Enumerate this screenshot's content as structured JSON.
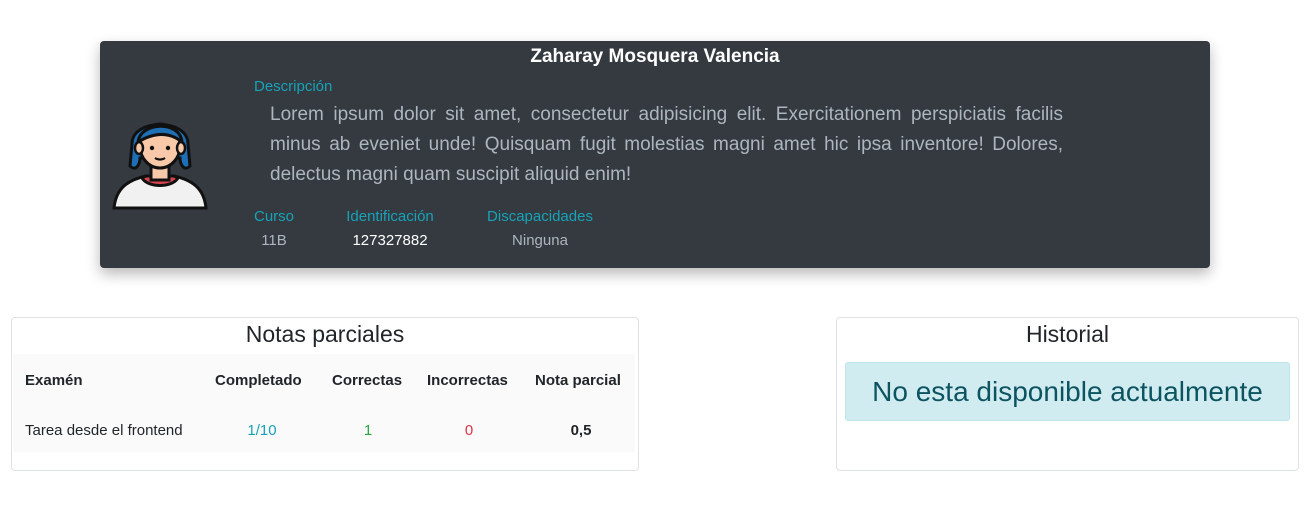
{
  "profile": {
    "name": "Zaharay Mosquera Valencia",
    "description_label": "Descripción",
    "description": "Lorem ipsum dolor sit amet, consectetur adipisicing elit. Exercitationem perspiciatis facilis minus ab eveniet unde! Quisquam fugit molestias magni amet hic ipsa inventore! Dolores, delectus magni quam suscipit aliquid enim!",
    "course_label": "Curso",
    "course": "11B",
    "id_label": "Identificación",
    "id": "127327882",
    "disabilities_label": "Discapacidades",
    "disabilities": "Ninguna",
    "avatar_icon": "student-avatar-icon"
  },
  "notes": {
    "title": "Notas parciales",
    "headers": [
      "Examén",
      "Completado",
      "Correctas",
      "Incorrectas",
      "Nota parcial"
    ],
    "rows": [
      {
        "exam": "Tarea desde el frontend",
        "completed": "1/10",
        "correct": "1",
        "incorrect": "0",
        "grade": "0,5"
      }
    ]
  },
  "history": {
    "title": "Historial",
    "message": "No esta disponible actualmente"
  },
  "colors": {
    "card_bg": "#343a40",
    "info": "#17a2b8",
    "success": "#28a745",
    "danger": "#dc3545",
    "alert_bg": "#d1ecf1",
    "alert_text": "#0c5460"
  }
}
